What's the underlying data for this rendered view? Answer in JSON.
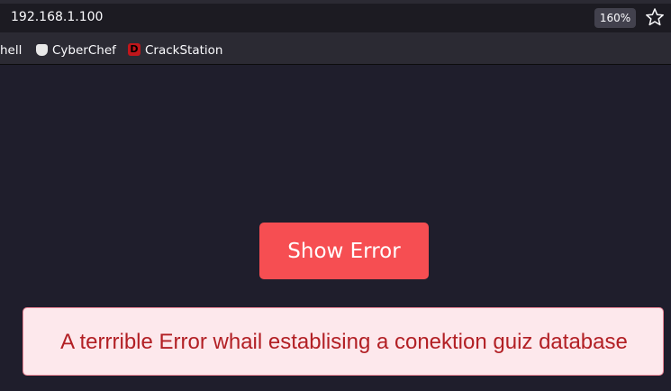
{
  "browser": {
    "url": "192.168.1.100",
    "zoom": "160%"
  },
  "bookmarks": [
    {
      "label": "hell",
      "icon": "none"
    },
    {
      "label": "CyberChef",
      "icon": "chef-hat-icon"
    },
    {
      "label": "CrackStation",
      "icon": "crackstation-icon"
    }
  ],
  "bookmark_icon_letters": {
    "crackstation": "D"
  },
  "page": {
    "button_label": "Show Error",
    "error_message": "A terrrible Error whail establising a conektion guiz database"
  },
  "colors": {
    "background": "#1f1e2c",
    "button": "#f64e52",
    "error_bg": "#fde8ec",
    "error_border": "#e37f90",
    "error_text": "#b21f24"
  }
}
